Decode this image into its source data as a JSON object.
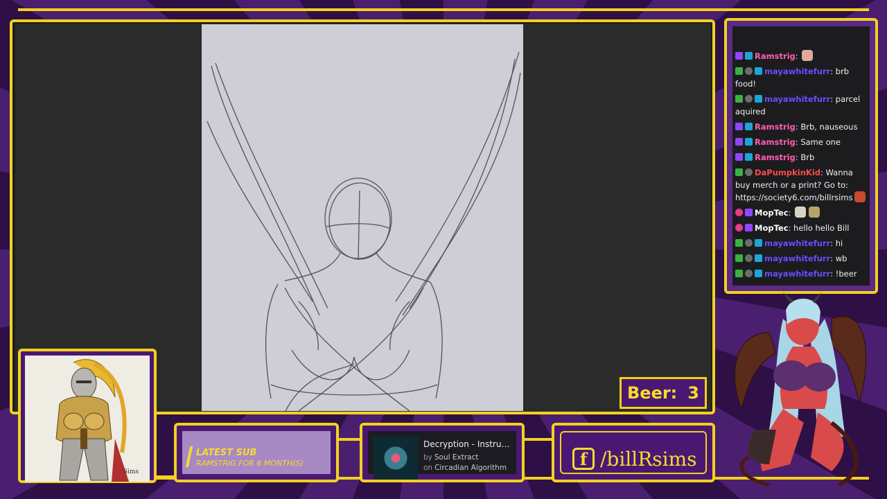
{
  "overlay": {
    "beer_label": "Beer:",
    "beer_count": "3",
    "latest_sub_title": "LATEST SUB",
    "latest_sub_detail": "RAMSTRIG FOR 6 MONTH(S)",
    "facebook_handle": "/billRsims",
    "colors": {
      "accent": "#f2d21d",
      "panel": "#4a1872",
      "background": "#3a1658"
    }
  },
  "now_playing": {
    "song": "Decryption - Instrumen...",
    "by_label": "by",
    "artist": "Soul Extract",
    "on_label": "on",
    "album": "Circadian Algorithm"
  },
  "chat": {
    "messages": [
      {
        "user": "Ramstrig",
        "color": "#ff5fae",
        "badges": [
          "sub",
          "prime"
        ],
        "text": "",
        "emotes": [
          "e1"
        ]
      },
      {
        "user": "mayawhitefurr",
        "color": "#6b4cff",
        "badges": [
          "mod",
          "tool",
          "prime"
        ],
        "text": "brb food!",
        "emotes": []
      },
      {
        "user": "mayawhitefurr",
        "color": "#6b4cff",
        "badges": [
          "mod",
          "tool",
          "prime"
        ],
        "text": "parcel aquired",
        "emotes": []
      },
      {
        "user": "Ramstrig",
        "color": "#ff5fae",
        "badges": [
          "sub",
          "prime"
        ],
        "text": "Brb, nauseous",
        "emotes": []
      },
      {
        "user": "Ramstrig",
        "color": "#ff5fae",
        "badges": [
          "sub",
          "prime"
        ],
        "text": "Same one",
        "emotes": []
      },
      {
        "user": "Ramstrig",
        "color": "#ff5fae",
        "badges": [
          "sub",
          "prime"
        ],
        "text": "Brb",
        "emotes": []
      },
      {
        "user": "DaPumpkinKid",
        "color": "#ff4a4a",
        "badges": [
          "mod",
          "tool"
        ],
        "text": "Wanna buy merch or a print? Go to: https://society6.com/billrsims",
        "emotes": [
          "e2"
        ]
      },
      {
        "user": "MopTec",
        "color": "#ffffff",
        "badges": [
          "heart",
          "sub"
        ],
        "text": "",
        "emotes": [
          "e3",
          "e4"
        ]
      },
      {
        "user": "MopTec",
        "color": "#ffffff",
        "badges": [
          "heart",
          "sub"
        ],
        "text": "hello hello Bill",
        "emotes": []
      },
      {
        "user": "mayawhitefurr",
        "color": "#6b4cff",
        "badges": [
          "mod",
          "tool",
          "prime"
        ],
        "text": "hi",
        "emotes": []
      },
      {
        "user": "mayawhitefurr",
        "color": "#6b4cff",
        "badges": [
          "mod",
          "tool",
          "prime"
        ],
        "text": "wb",
        "emotes": []
      },
      {
        "user": "mayawhitefurr",
        "color": "#6b4cff",
        "badges": [
          "mod",
          "tool",
          "prime"
        ],
        "text": "!beer",
        "emotes": []
      }
    ]
  }
}
